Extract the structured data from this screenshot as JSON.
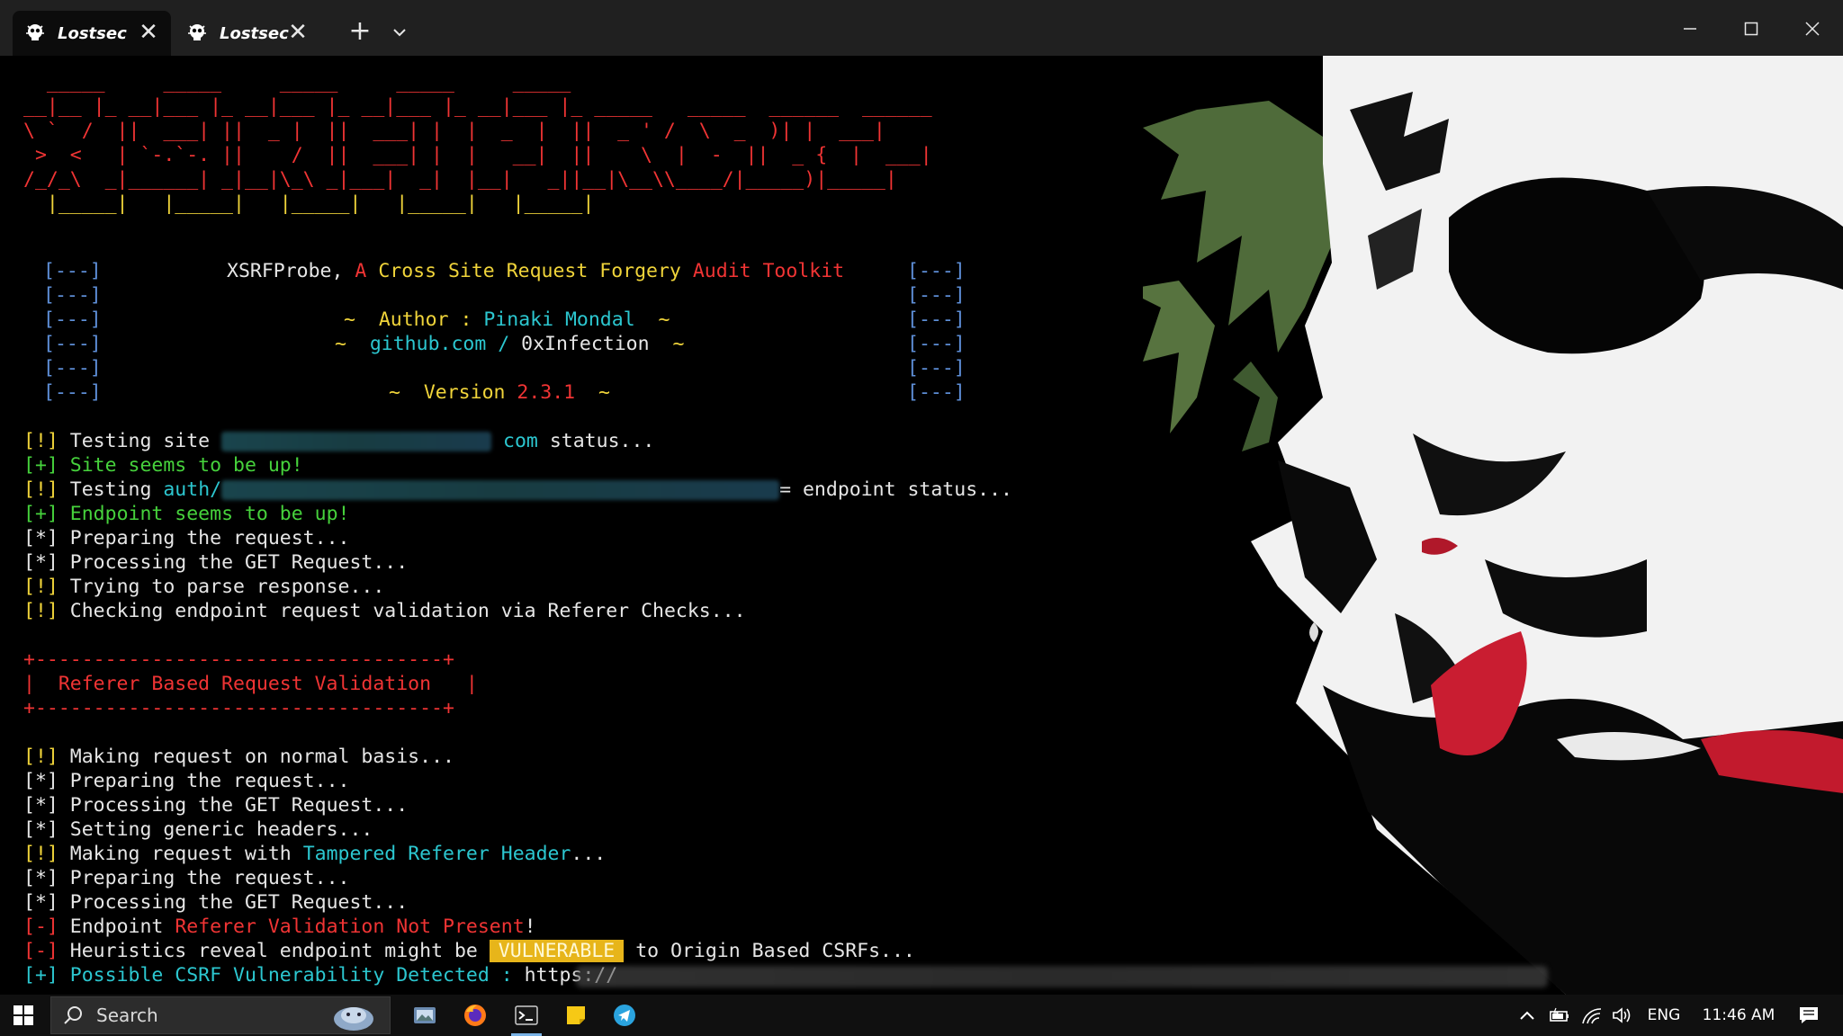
{
  "window": {
    "tabs": [
      {
        "label": "Lostsec",
        "active": true
      },
      {
        "label": "Lostsec",
        "active": false
      }
    ],
    "new_tab_glyph": "+",
    "close_glyph": "✕"
  },
  "terminal": {
    "banner_art_lines": [
      "  _____     _____     _____     _____     _____",
      "__|__ |_ __|___ |_ __|___ |_ __|___ |_ __|___ |_ _____   _____  ______  ______",
      "\\ `  /  ||  ___| ||  _ |  ||  ___| |  |  _  |  ||  _ ' /  \\  _  )| |  ___|",
      " >  <   | `-.`-. ||    /  ||  ___| |  |   __|  ||    \\  |  -  ||  _ {  |  ___|",
      "/_/_\\  _|______| _|__|\\_\\ _|___|  _|  |__|   _||__|\\__\\\\____/|_____)|_____|",
      "  |_____|   |_____|   |_____|   |_____|   |_____|"
    ],
    "box_marker": "[---]",
    "header": {
      "title_name": "XSRFProbe,",
      "title_a": "A",
      "title_middle": "Cross Site Request Forgery",
      "title_end": "Audit Toolkit",
      "tilde": "~",
      "author_label": "Author :",
      "author_name": "Pinaki Mondal",
      "github_host": "github.com",
      "github_slash": "/",
      "github_user": "0xInfection",
      "version_label": "Version",
      "version_number": "2.3.1"
    },
    "log": {
      "testing_site": "Testing site",
      "site_suffix": "com",
      "site_status": "status...",
      "site_up": "Site seems to be up!",
      "testing_label": "Testing",
      "endpoint_prefix": "auth/",
      "endpoint_suffix": "= endpoint status...",
      "endpoint_up": "Endpoint seems to be up!",
      "preparing": "Preparing the request...",
      "processing_get": "Processing the GET Request...",
      "parsing": "Trying to parse response...",
      "checking_pre": "Checking endpoint request validation via",
      "checking_highlight": "Referer",
      "checking_post": "Checks...",
      "section_rule": "+-----------------------------------+",
      "section_title": "|  Referer Based Request Validation   |",
      "normal_request": "Making request on normal basis...",
      "generic_headers": "Setting generic headers...",
      "tampered_pre": "Making request with",
      "tampered_highlight": "Tampered Referer Header",
      "tampered_post": "...",
      "endpoint_word": "Endpoint",
      "referer_missing": "Referer Validation Not Present",
      "exclaim": "!",
      "heuristics_pre": "Heuristics reveal endpoint might be",
      "vulnerable": "VULNERABLE",
      "heuristics_post": "to Origin Based CSRFs...",
      "possible_csrf": "Possible CSRF Vulnerability Detected :",
      "url_prefix": "https://"
    },
    "prefixes": {
      "info": "[!]",
      "ok": "[+]",
      "step": "[*]",
      "bad": "[-]"
    }
  },
  "taskbar": {
    "search_placeholder": "Search",
    "language": "ENG",
    "time": "11:46 AM"
  }
}
